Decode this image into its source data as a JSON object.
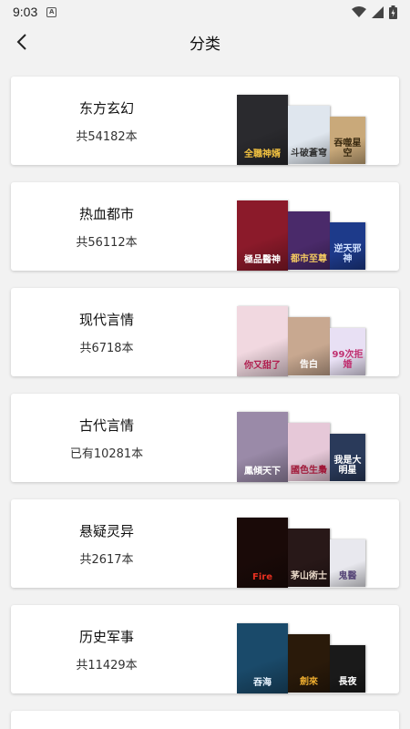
{
  "status_bar": {
    "time": "9:03",
    "notification_icon": "A"
  },
  "header": {
    "title": "分类"
  },
  "categories": [
    {
      "name": "东方玄幻",
      "count": "共54182本",
      "covers": [
        {
          "title": "全職神婿",
          "bg": "#2a2a2e",
          "fg": "#f0c040"
        },
        {
          "title": "斗破蒼穹",
          "bg": "#dfe6ee",
          "fg": "#333"
        },
        {
          "title": "吞噬星空",
          "bg": "#c9a97a",
          "fg": "#3a2a10"
        }
      ]
    },
    {
      "name": "热血都市",
      "count": "共56112本",
      "covers": [
        {
          "title": "極品醫神",
          "bg": "#8b1a2a",
          "fg": "#fff"
        },
        {
          "title": "都市至尊",
          "bg": "#4a2a6a",
          "fg": "#f2c860"
        },
        {
          "title": "逆天邪神",
          "bg": "#1d3a8a",
          "fg": "#cfe0ff"
        }
      ]
    },
    {
      "name": "现代言情",
      "count": "共6718本",
      "covers": [
        {
          "title": "你又甜了",
          "bg": "#f1d8e0",
          "fg": "#b02050"
        },
        {
          "title": "告白",
          "bg": "#c8a890",
          "fg": "#fff"
        },
        {
          "title": "99次拒婚",
          "bg": "#e8e0f4",
          "fg": "#c03070"
        }
      ]
    },
    {
      "name": "古代言情",
      "count": "已有10281本",
      "covers": [
        {
          "title": "鳳傾天下",
          "bg": "#9a8aa8",
          "fg": "#fff"
        },
        {
          "title": "國色生梟",
          "bg": "#e6c8d8",
          "fg": "#a01838"
        },
        {
          "title": "我是大明星",
          "bg": "#2a3a5a",
          "fg": "#fff"
        }
      ]
    },
    {
      "name": "悬疑灵异",
      "count": "共2617本",
      "covers": [
        {
          "title": "Fire",
          "bg": "#1a0a08",
          "fg": "#e83020"
        },
        {
          "title": "茅山術士",
          "bg": "#281818",
          "fg": "#e8d8c8"
        },
        {
          "title": "鬼醫",
          "bg": "#e8e8ee",
          "fg": "#5a4a7a"
        }
      ]
    },
    {
      "name": "历史军事",
      "count": "共11429本",
      "covers": [
        {
          "title": "吞海",
          "bg": "#1a4a6a",
          "fg": "#e8f4ff"
        },
        {
          "title": "劍來",
          "bg": "#2a1a0a",
          "fg": "#f2b030"
        },
        {
          "title": "長夜",
          "bg": "#1a1a1a",
          "fg": "#ffffff"
        }
      ]
    }
  ]
}
